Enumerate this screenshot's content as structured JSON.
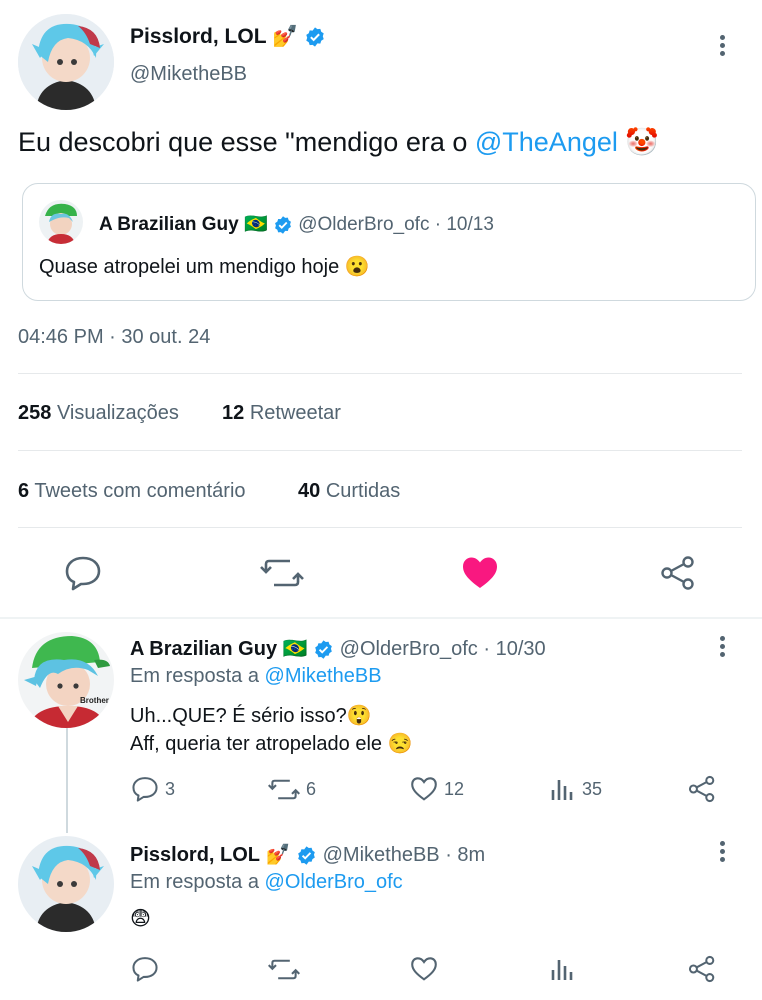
{
  "main_tweet": {
    "display_name": "Pisslord, LOL",
    "handle": "@MiketheBB",
    "text_prefix": "Eu descobri que esse \"mendigo era o ",
    "mention": "@TheAngel",
    "text_emoji": "🤡",
    "name_emoji": "💅",
    "timestamp": "04:46 PM · 30 out. 24"
  },
  "quoted_tweet": {
    "display_name": "A Brazilian Guy",
    "flag": "🇧🇷",
    "handle": "@OlderBro_ofc · 10/13",
    "text": "Quase atropelei um mendigo hoje 😮"
  },
  "stats": {
    "views_count": "258",
    "views_label": "Visualizações",
    "retweets_count": "12",
    "retweets_label": "Retweetar",
    "quotes_count": "6",
    "quotes_label": "Tweets com comentário",
    "likes_count": "40",
    "likes_label": "Curtidas"
  },
  "replies": [
    {
      "display_name": "A Brazilian Guy",
      "flag": "🇧🇷",
      "meta": "@OlderBro_ofc · 10/30",
      "reply_prefix": "Em resposta a",
      "reply_to": "@MiketheBB",
      "line1": "Uh...QUE? É sério isso?😲",
      "line2": "Aff, queria ter atropelado ele 😒",
      "avatar_caption": "Brother",
      "replies_count": "3",
      "retweets_count": "6",
      "likes_count": "12",
      "views_count": "35"
    },
    {
      "display_name": "Pisslord, LOL",
      "name_emoji": "💅",
      "meta": "@MiketheBB · 8m",
      "reply_prefix": "Em resposta a",
      "reply_to": "@OlderBro_ofc",
      "line1": "😨"
    }
  ],
  "colors": {
    "accent": "#1d9bf0",
    "like": "#f91880",
    "text": "#0f1419",
    "secondary": "#536471"
  }
}
